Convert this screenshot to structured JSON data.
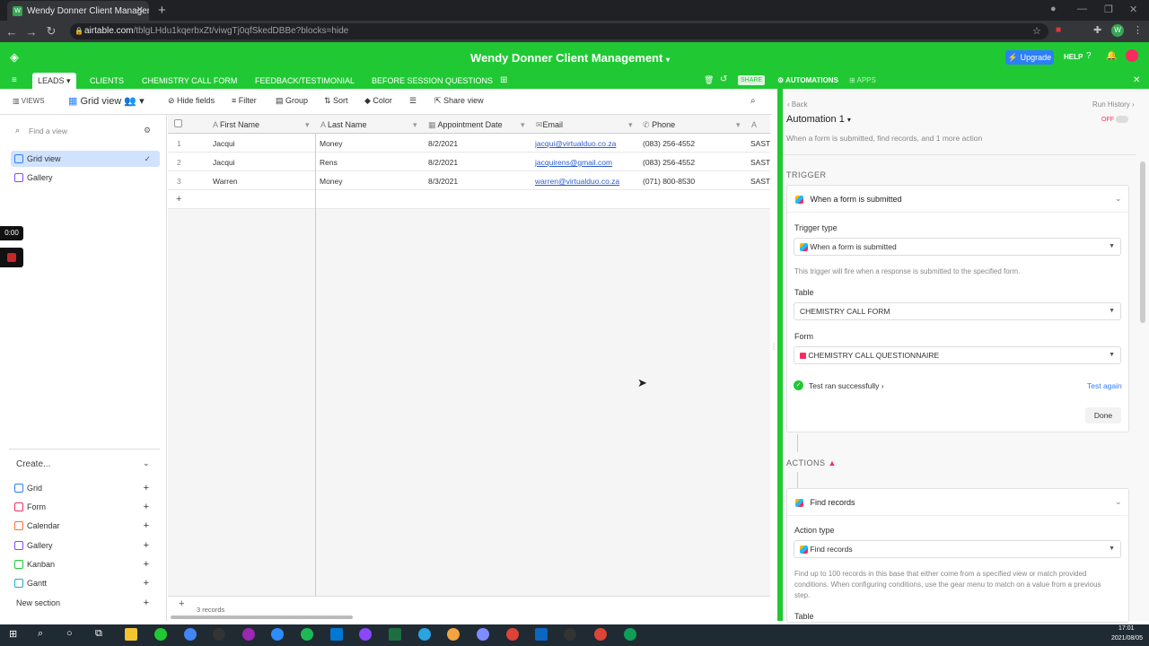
{
  "browser": {
    "tab_title": "Wendy Donner Client Management",
    "url_host": "airtable.com",
    "url_path": "/tblgLHdu1kqerbxZt/viwgTj0qfSkedDBBe?blocks=hide"
  },
  "header": {
    "base_title": "Wendy Donner Client Management",
    "upgrade_label": "Upgrade",
    "help_label": "HELP"
  },
  "tables": [
    "LEADS",
    "CLIENTS",
    "CHEMISTRY CALL FORM",
    "FEEDBACK/TESTIMONIAL",
    "BEFORE SESSION QUESTIONS"
  ],
  "top_right": {
    "share": "SHARE",
    "automations": "AUTOMATIONS",
    "apps": "APPS"
  },
  "viewbar": {
    "views_label": "VIEWS",
    "current_view": "Grid view",
    "hide_fields": "Hide fields",
    "filter": "Filter",
    "group": "Group",
    "sort": "Sort",
    "color": "Color",
    "share_view": "Share view"
  },
  "sidebar": {
    "search_placeholder": "Find a view",
    "views": [
      "Grid view",
      "Gallery"
    ],
    "timer": "0:00",
    "create_label": "Create...",
    "create_items": [
      "Grid",
      "Form",
      "Calendar",
      "Gallery",
      "Kanban",
      "Gantt"
    ],
    "new_section": "New section"
  },
  "grid": {
    "columns": [
      "First Name",
      "Last Name",
      "Appointment Date",
      "Email",
      "Phone"
    ],
    "rows": [
      {
        "n": "1",
        "first": "Jacqui",
        "last": "Money",
        "date": "8/2/2021",
        "email": "jacqui@virtualduo.co.za",
        "phone": "(083) 256-4552",
        "tz": "SAST"
      },
      {
        "n": "2",
        "first": "Jacqui",
        "last": "Rens",
        "date": "8/2/2021",
        "email": "jacquirens@gmail.com",
        "phone": "(083) 256-4552",
        "tz": "SAST"
      },
      {
        "n": "3",
        "first": "Warren",
        "last": "Money",
        "date": "8/3/2021",
        "email": "warren@virtualduo.co.za",
        "phone": "(071) 800-8530",
        "tz": "SAST"
      }
    ],
    "record_count": "3 records"
  },
  "automation": {
    "back": "Back",
    "run_history": "Run History",
    "toggle": "OFF",
    "name": "Automation 1",
    "description": "When a form is submitted, find records, and 1 more action",
    "trigger_section": "TRIGGER",
    "trigger_title": "When a form is submitted",
    "trigger_type_label": "Trigger type",
    "trigger_type_value": "When a form is submitted",
    "trigger_help": "This trigger will fire when a response is submitted to the specified form.",
    "table_label": "Table",
    "table_value": "CHEMISTRY CALL FORM",
    "form_label": "Form",
    "form_value": "CHEMISTRY CALL QUESTIONNAIRE",
    "test_status": "Test ran successfully",
    "test_again": "Test again",
    "done": "Done",
    "actions_section": "ACTIONS",
    "action_title": "Find records",
    "action_type_label": "Action type",
    "action_type_value": "Find records",
    "action_help": "Find up to 100 records in this base that either come from a specified view or match provided conditions. When configuring conditions, use the gear menu to match on a value from a previous step.",
    "action_table_label": "Table"
  },
  "taskbar": {
    "time": "17:01",
    "date": "2021/08/05"
  },
  "colors": {
    "brand_green": "#20c933",
    "selected_view": "#d1e2ff",
    "link": "#2d5ccf"
  }
}
